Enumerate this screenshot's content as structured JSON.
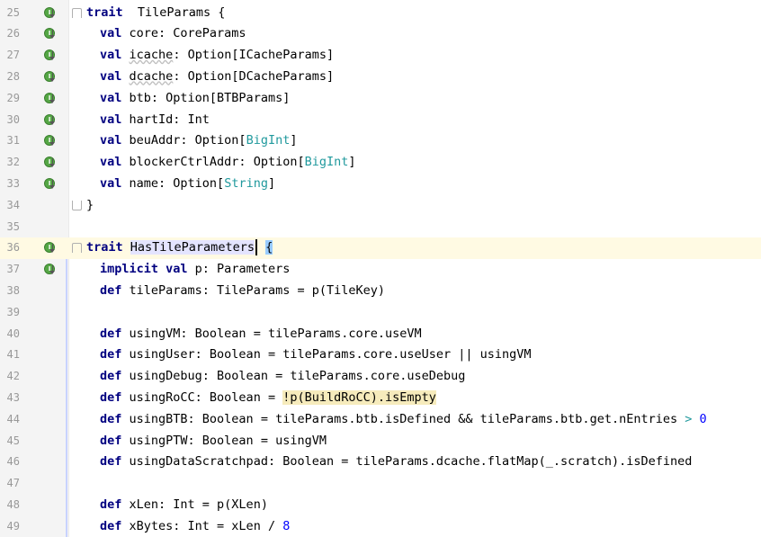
{
  "editor": {
    "lines": [
      {
        "n": "25",
        "marker": true,
        "fold": "open",
        "indent": 0,
        "tokens": [
          [
            "kw",
            "trait"
          ],
          [
            "",
            "  TileParams {"
          ]
        ]
      },
      {
        "n": "26",
        "marker": true,
        "indent": 1,
        "tokens": [
          [
            "kw",
            "val"
          ],
          [
            "",
            " core: CoreParams"
          ]
        ]
      },
      {
        "n": "27",
        "marker": true,
        "indent": 1,
        "tokens": [
          [
            "kw",
            "val"
          ],
          [
            "",
            " "
          ],
          [
            "squig",
            "icache"
          ],
          [
            "",
            ": Option[ICacheParams]"
          ]
        ]
      },
      {
        "n": "28",
        "marker": true,
        "indent": 1,
        "tokens": [
          [
            "kw",
            "val"
          ],
          [
            "",
            " "
          ],
          [
            "squig",
            "dcache"
          ],
          [
            "",
            ": Option[DCacheParams]"
          ]
        ]
      },
      {
        "n": "29",
        "marker": true,
        "indent": 1,
        "tokens": [
          [
            "kw",
            "val"
          ],
          [
            "",
            " btb: Option[BTBParams]"
          ]
        ]
      },
      {
        "n": "30",
        "marker": true,
        "indent": 1,
        "tokens": [
          [
            "kw",
            "val"
          ],
          [
            "",
            " hartId: Int"
          ]
        ]
      },
      {
        "n": "31",
        "marker": true,
        "indent": 1,
        "tokens": [
          [
            "kw",
            "val"
          ],
          [
            "",
            " beuAddr: Option["
          ],
          [
            "typ",
            "BigInt"
          ],
          [
            "",
            "]"
          ]
        ]
      },
      {
        "n": "32",
        "marker": true,
        "indent": 1,
        "tokens": [
          [
            "kw",
            "val"
          ],
          [
            "",
            " blockerCtrlAddr: Option["
          ],
          [
            "typ",
            "BigInt"
          ],
          [
            "",
            "]"
          ]
        ]
      },
      {
        "n": "33",
        "marker": true,
        "indent": 1,
        "tokens": [
          [
            "kw",
            "val"
          ],
          [
            "",
            " name: Option["
          ],
          [
            "typ",
            "String"
          ],
          [
            "",
            "]"
          ]
        ]
      },
      {
        "n": "34",
        "marker": false,
        "fold": "close",
        "indent": 0,
        "tokens": [
          [
            "",
            "}"
          ]
        ]
      },
      {
        "n": "35",
        "marker": false,
        "indent": 0,
        "tokens": []
      },
      {
        "n": "36",
        "marker": true,
        "fold": "open",
        "current": true,
        "indent": 0,
        "tokens": [
          [
            "kw",
            "trait"
          ],
          [
            "",
            " "
          ],
          [
            "hl-ident",
            "HasTileParameters"
          ],
          [
            "caret",
            ""
          ],
          [
            "",
            " "
          ],
          [
            "hl-bracket",
            "{"
          ]
        ]
      },
      {
        "n": "37",
        "marker": true,
        "indent": 1,
        "tokens": [
          [
            "kw",
            "implicit val"
          ],
          [
            "",
            " p: Parameters"
          ]
        ]
      },
      {
        "n": "38",
        "marker": false,
        "indent": 1,
        "tokens": [
          [
            "kw",
            "def"
          ],
          [
            "",
            " tileParams: TileParams = p(TileKey)"
          ]
        ]
      },
      {
        "n": "39",
        "marker": false,
        "indent": 0,
        "tokens": []
      },
      {
        "n": "40",
        "marker": false,
        "indent": 1,
        "tokens": [
          [
            "kw",
            "def"
          ],
          [
            "",
            " usingVM: Boolean = tileParams.core.useVM"
          ]
        ]
      },
      {
        "n": "41",
        "marker": false,
        "indent": 1,
        "tokens": [
          [
            "kw",
            "def"
          ],
          [
            "",
            " usingUser: Boolean = tileParams.core.useUser || usingVM"
          ]
        ]
      },
      {
        "n": "42",
        "marker": false,
        "indent": 1,
        "tokens": [
          [
            "kw",
            "def"
          ],
          [
            "",
            " usingDebug: Boolean = tileParams.core.useDebug"
          ]
        ]
      },
      {
        "n": "43",
        "marker": false,
        "indent": 1,
        "tokens": [
          [
            "kw",
            "def"
          ],
          [
            "",
            " usingRoCC: Boolean = "
          ],
          [
            "hl-warn",
            "!p(BuildRoCC).isEmpty"
          ]
        ]
      },
      {
        "n": "44",
        "marker": false,
        "indent": 1,
        "tokens": [
          [
            "kw",
            "def"
          ],
          [
            "",
            " usingBTB: Boolean = tileParams.btb.isDefined && tileParams.btb.get.nEntries "
          ],
          [
            "typ",
            ">"
          ],
          [
            "",
            " "
          ],
          [
            "num",
            "0"
          ]
        ]
      },
      {
        "n": "45",
        "marker": false,
        "indent": 1,
        "tokens": [
          [
            "kw",
            "def"
          ],
          [
            "",
            " usingPTW: Boolean = usingVM"
          ]
        ]
      },
      {
        "n": "46",
        "marker": false,
        "indent": 1,
        "tokens": [
          [
            "kw",
            "def"
          ],
          [
            "",
            " usingDataScratchpad: Boolean = tileParams.dcache.flatMap(_.scratch).isDefined"
          ]
        ]
      },
      {
        "n": "47",
        "marker": false,
        "indent": 0,
        "tokens": []
      },
      {
        "n": "48",
        "marker": false,
        "indent": 1,
        "tokens": [
          [
            "kw",
            "def"
          ],
          [
            "",
            " xLen: Int = p(XLen)"
          ]
        ]
      },
      {
        "n": "49",
        "marker": false,
        "indent": 1,
        "tokens": [
          [
            "kw",
            "def"
          ],
          [
            "",
            " xBytes: Int = xLen / "
          ],
          [
            "num",
            "8"
          ]
        ]
      }
    ]
  }
}
